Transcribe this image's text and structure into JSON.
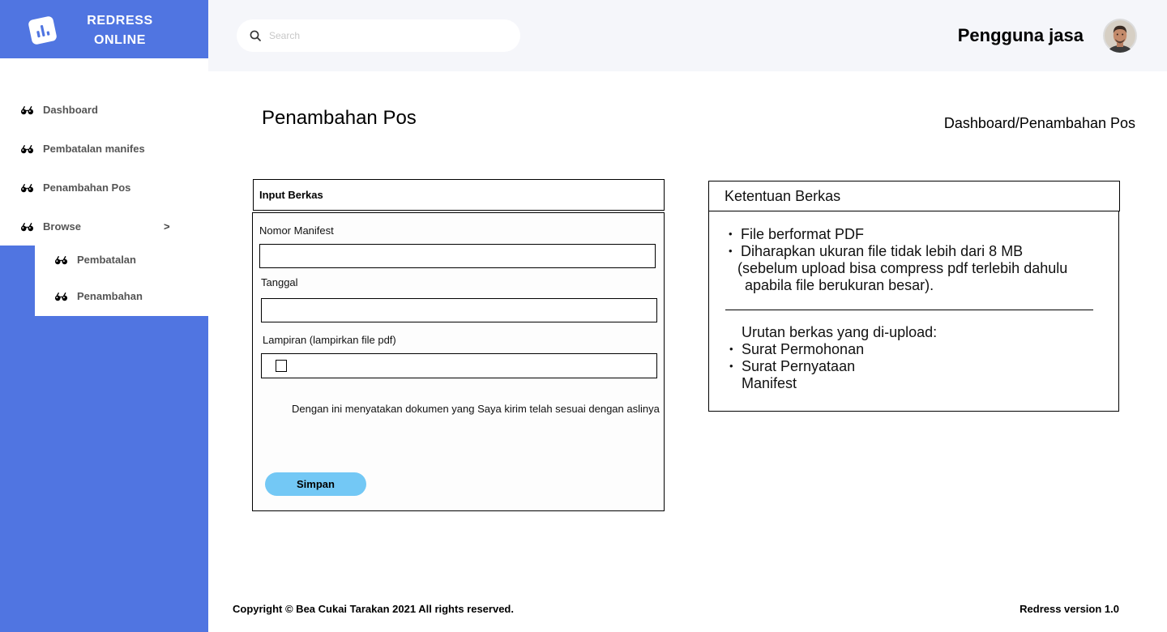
{
  "brand": {
    "line1": "REDRESS",
    "line2": "ONLINE",
    "logo_icon": "bar-chart-icon"
  },
  "sidebar": {
    "items": [
      {
        "label": "Dashboard",
        "icon": "glasses-icon"
      },
      {
        "label": "Pembatalan manifes",
        "icon": "glasses-icon"
      },
      {
        "label": "Penambahan Pos",
        "icon": "glasses-icon"
      },
      {
        "label": "Browse",
        "icon": "glasses-icon",
        "chevron": ">"
      }
    ],
    "browse_submenu": [
      {
        "label": "Pembatalan",
        "icon": "glasses-icon"
      },
      {
        "label": "Penambahan",
        "icon": "glasses-icon"
      }
    ]
  },
  "header": {
    "search": {
      "placeholder": "Search",
      "value": "",
      "icon": "search-icon"
    },
    "user": {
      "name": "Pengguna jasa",
      "avatar_icon": "user-avatar-photo"
    }
  },
  "page": {
    "title": "Penambahan Pos",
    "breadcrumb": "Dashboard/Penambahan Pos"
  },
  "form": {
    "title": "Input Berkas",
    "nomor_manifest": {
      "label": "Nomor Manifest",
      "value": ""
    },
    "tanggal": {
      "label": "Tanggal",
      "value": ""
    },
    "lampiran": {
      "label": "Lampiran (lampirkan file pdf)"
    },
    "declaration": "Dengan ini menyatakan dokumen yang Saya kirim telah sesuai dengan aslinya",
    "submit_label": "Simpan"
  },
  "rules": {
    "title": "Ketentuan Berkas",
    "file_rules": [
      "File berformat PDF",
      "Diharapkan ukuran file tidak lebih dari 8 MB"
    ],
    "file_rules_note": [
      "(sebelum upload bisa compress pdf terlebih dahulu",
      "apabila file berukuran besar)."
    ],
    "upload_order_heading": "Urutan berkas yang di-upload:",
    "upload_order": [
      "Surat Permohonan",
      "Surat Pernyataan"
    ],
    "upload_order_continuation": "Manifest"
  },
  "footer": {
    "copyright": "Copyright © Bea Cukai Tarakan 2021 All rights reserved.",
    "version": "Redress version 1.0"
  },
  "colors": {
    "sidebar": "#5075E1",
    "topbar": "#F5F6FA",
    "button": "#73C8F5",
    "menu_text": "#555555"
  }
}
